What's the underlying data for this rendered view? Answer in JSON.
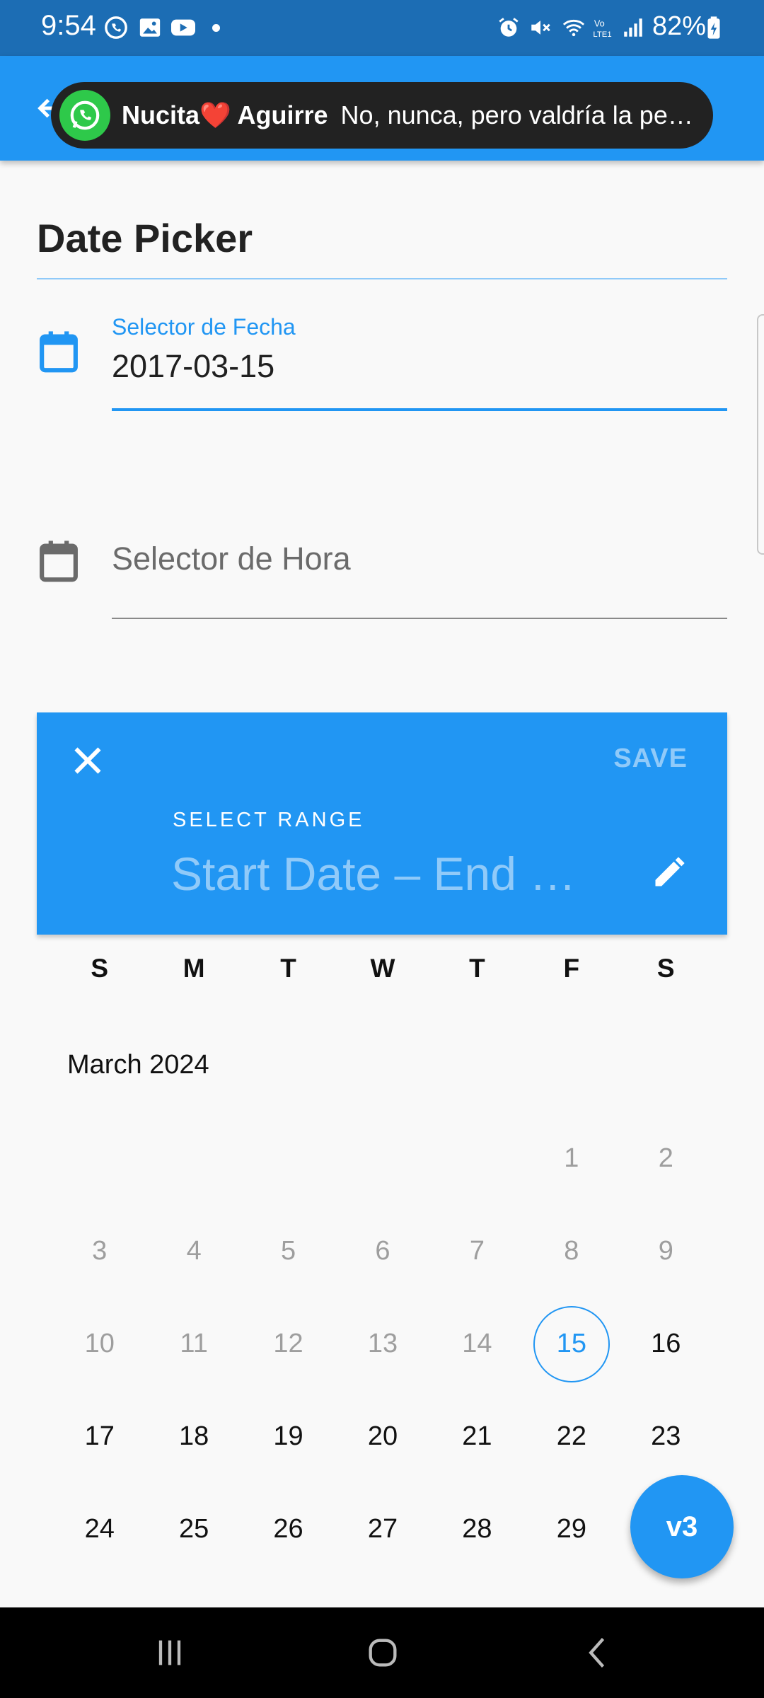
{
  "status_bar": {
    "time": "9:54",
    "battery": "82%",
    "icons": [
      "whatsapp-icon",
      "gallery-icon",
      "youtube-icon",
      "alarm-icon",
      "mute-icon",
      "wifi-icon",
      "volte-icon",
      "signal-icon",
      "battery-icon"
    ]
  },
  "notification": {
    "sender": "Nucita❤️ Aguirre",
    "message": "No, nunca, pero valdría la pena",
    "app_icon": "whatsapp-icon"
  },
  "page": {
    "title": "Date Picker"
  },
  "date_field": {
    "label": "Selector de Fecha",
    "value": "2017-03-15",
    "icon": "calendar-icon"
  },
  "time_field": {
    "placeholder": "Selector de Hora",
    "icon": "calendar-icon"
  },
  "range_picker": {
    "save_label": "SAVE",
    "select_range_label": "SELECT RANGE",
    "range_text": "Start Date – End …",
    "weekdays": [
      "S",
      "M",
      "T",
      "W",
      "T",
      "F",
      "S"
    ],
    "month_label": "March 2024",
    "days": [
      {
        "label": "",
        "state": "empty"
      },
      {
        "label": "",
        "state": "empty"
      },
      {
        "label": "",
        "state": "empty"
      },
      {
        "label": "",
        "state": "empty"
      },
      {
        "label": "",
        "state": "empty"
      },
      {
        "label": "1",
        "state": "disabled"
      },
      {
        "label": "2",
        "state": "disabled"
      },
      {
        "label": "3",
        "state": "disabled"
      },
      {
        "label": "4",
        "state": "disabled"
      },
      {
        "label": "5",
        "state": "disabled"
      },
      {
        "label": "6",
        "state": "disabled"
      },
      {
        "label": "7",
        "state": "disabled"
      },
      {
        "label": "8",
        "state": "disabled"
      },
      {
        "label": "9",
        "state": "disabled"
      },
      {
        "label": "10",
        "state": "disabled"
      },
      {
        "label": "11",
        "state": "disabled"
      },
      {
        "label": "12",
        "state": "disabled"
      },
      {
        "label": "13",
        "state": "disabled"
      },
      {
        "label": "14",
        "state": "disabled"
      },
      {
        "label": "15",
        "state": "today"
      },
      {
        "label": "16",
        "state": "enabled"
      },
      {
        "label": "17",
        "state": "enabled"
      },
      {
        "label": "18",
        "state": "enabled"
      },
      {
        "label": "19",
        "state": "enabled"
      },
      {
        "label": "20",
        "state": "enabled"
      },
      {
        "label": "21",
        "state": "enabled"
      },
      {
        "label": "22",
        "state": "enabled"
      },
      {
        "label": "23",
        "state": "enabled"
      },
      {
        "label": "24",
        "state": "enabled"
      },
      {
        "label": "25",
        "state": "enabled"
      },
      {
        "label": "26",
        "state": "enabled"
      },
      {
        "label": "27",
        "state": "enabled"
      },
      {
        "label": "28",
        "state": "enabled"
      },
      {
        "label": "29",
        "state": "enabled"
      }
    ]
  },
  "fab": {
    "label": "v3"
  },
  "colors": {
    "primary": "#2196f3",
    "status_bar": "#1c6db4",
    "save_disabled": "#90caf9"
  }
}
